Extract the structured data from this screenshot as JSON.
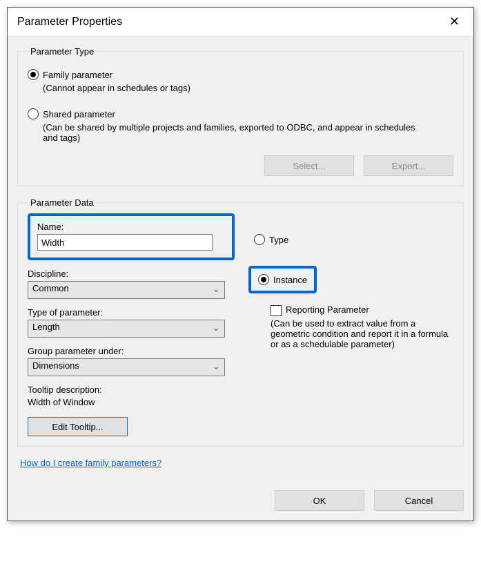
{
  "dialog": {
    "title": "Parameter Properties",
    "close_icon": "✕"
  },
  "parameter_type": {
    "legend": "Parameter Type",
    "family": {
      "label": "Family parameter",
      "desc": "(Cannot appear in schedules or tags)",
      "checked": true
    },
    "shared": {
      "label": "Shared parameter",
      "desc": "(Can be shared by multiple projects and families, exported to ODBC, and appear in schedules and tags)",
      "checked": false
    },
    "select_btn": "Select...",
    "export_btn": "Export..."
  },
  "parameter_data": {
    "legend": "Parameter Data",
    "name_label": "Name:",
    "name_value": "Width",
    "discipline_label": "Discipline:",
    "discipline_value": "Common",
    "type_of_param_label": "Type of parameter:",
    "type_of_param_value": "Length",
    "group_under_label": "Group parameter under:",
    "group_under_value": "Dimensions",
    "tooltip_label": "Tooltip description:",
    "tooltip_value": "Width of Window",
    "edit_tooltip_btn": "Edit Tooltip...",
    "type_radio": {
      "label": "Type",
      "checked": false
    },
    "instance_radio": {
      "label": "Instance",
      "checked": true
    },
    "reporting": {
      "label": "Reporting Parameter",
      "desc": "(Can be used to extract value from a geometric condition and report it in a formula or as a schedulable parameter)",
      "checked": false
    }
  },
  "help_link": "How do I create family parameters?",
  "buttons": {
    "ok": "OK",
    "cancel": "Cancel"
  },
  "colors": {
    "highlight": "#0066cc"
  }
}
